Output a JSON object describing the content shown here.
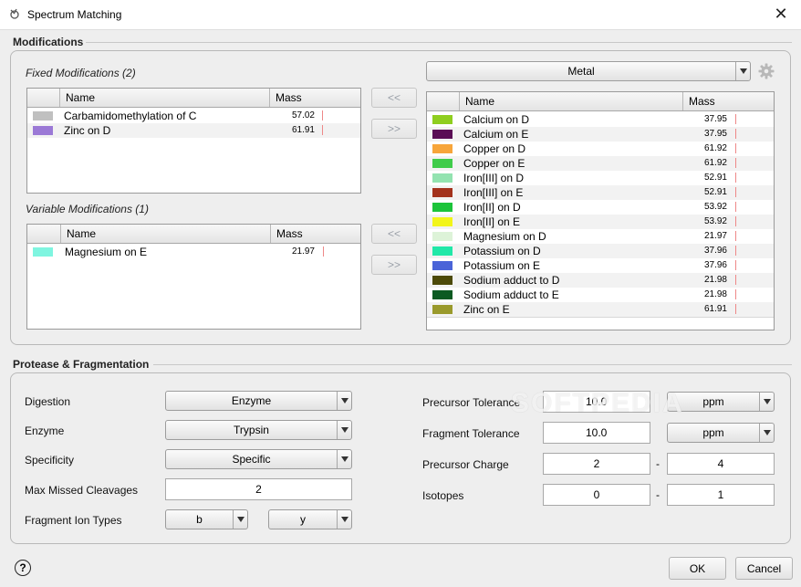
{
  "window": {
    "title": "Spectrum Matching",
    "close_glyph": "✕"
  },
  "modifications": {
    "section_title": "Modifications",
    "fixed_title": "Fixed Modifications (2)",
    "variable_title": "Variable Modifications (1)",
    "col_name": "Name",
    "col_mass": "Mass",
    "fixed": [
      {
        "name": "Carbamidomethylation of C",
        "mass": "57.02",
        "color": "#c0c0c0"
      },
      {
        "name": "Zinc on D",
        "mass": "61.91",
        "color": "#9b79d6"
      }
    ],
    "variable": [
      {
        "name": "Magnesium on E",
        "mass": "21.97",
        "color": "#7ff5e0"
      }
    ],
    "move_left": "<<",
    "move_right": ">>",
    "category_select": "Metal",
    "available": [
      {
        "name": "Calcium on D",
        "mass": "37.95",
        "color": "#8fce1f"
      },
      {
        "name": "Calcium on E",
        "mass": "37.95",
        "color": "#5a0d55"
      },
      {
        "name": "Copper on D",
        "mass": "61.92",
        "color": "#f7a53a"
      },
      {
        "name": "Copper on E",
        "mass": "61.92",
        "color": "#3fcc4a"
      },
      {
        "name": "Iron[III] on D",
        "mass": "52.91",
        "color": "#93e3b0"
      },
      {
        "name": "Iron[III] on E",
        "mass": "52.91",
        "color": "#a3321c"
      },
      {
        "name": "Iron[II] on D",
        "mass": "53.92",
        "color": "#1cc43a"
      },
      {
        "name": "Iron[II] on E",
        "mass": "53.92",
        "color": "#f2f51a"
      },
      {
        "name": "Magnesium on D",
        "mass": "21.97",
        "color": "#ddf3d8"
      },
      {
        "name": "Potassium on D",
        "mass": "37.96",
        "color": "#21e8a8"
      },
      {
        "name": "Potassium on E",
        "mass": "37.96",
        "color": "#4a64d8"
      },
      {
        "name": "Sodium adduct to D",
        "mass": "21.98",
        "color": "#4d4a09"
      },
      {
        "name": "Sodium adduct to E",
        "mass": "21.98",
        "color": "#0c5a22"
      },
      {
        "name": "Zinc on E",
        "mass": "61.91",
        "color": "#9a9a2c"
      }
    ]
  },
  "protease": {
    "section_title": "Protease & Fragmentation",
    "digestion_label": "Digestion",
    "digestion_value": "Enzyme",
    "enzyme_label": "Enzyme",
    "enzyme_value": "Trypsin",
    "specificity_label": "Specificity",
    "specificity_value": "Specific",
    "missed_label": "Max Missed Cleavages",
    "missed_value": "2",
    "ion_label": "Fragment Ion Types",
    "ion_1": "b",
    "ion_2": "y",
    "prec_tol_label": "Precursor Tolerance",
    "prec_tol_value": "10.0",
    "prec_tol_unit": "ppm",
    "frag_tol_label": "Fragment Tolerance",
    "frag_tol_value": "10.0",
    "frag_tol_unit": "ppm",
    "charge_label": "Precursor Charge",
    "charge_min": "2",
    "charge_max": "4",
    "isotopes_label": "Isotopes",
    "iso_min": "0",
    "iso_max": "1",
    "range_sep": "-"
  },
  "footer": {
    "help": "?",
    "ok": "OK",
    "cancel": "Cancel"
  },
  "watermark": "SOFTPEDIA"
}
